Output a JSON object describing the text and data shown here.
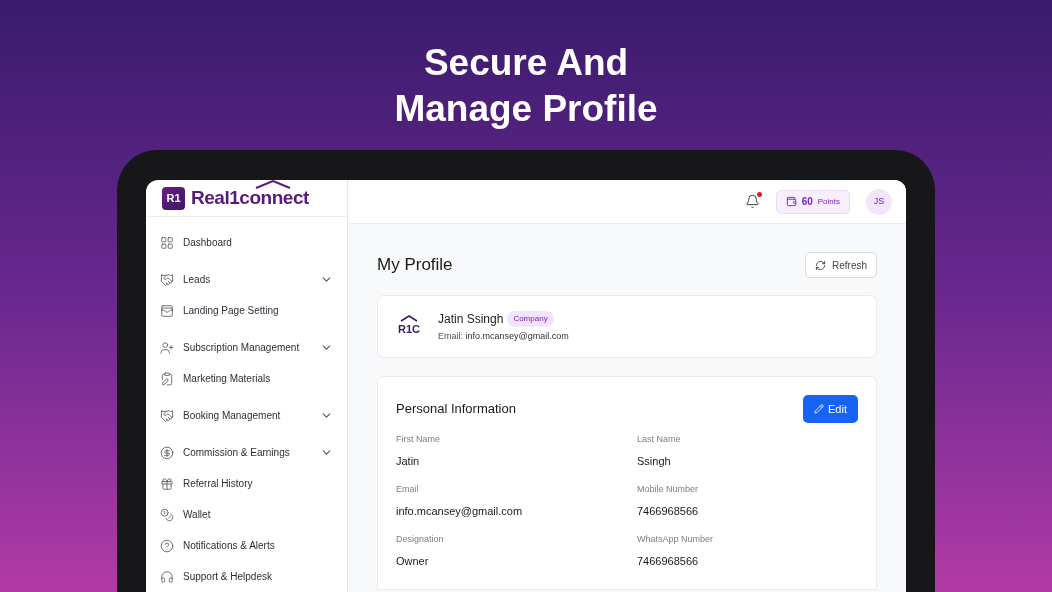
{
  "headline": [
    "Secure And",
    "Manage Profile"
  ],
  "logo": {
    "badge": "R1",
    "name": "Real1connect"
  },
  "sidebar": {
    "items": [
      {
        "label": "Dashboard",
        "expandable": false
      },
      {
        "label": "Leads",
        "expandable": true
      },
      {
        "label": "Landing Page Setting",
        "expandable": false
      },
      {
        "label": "Subscription Management",
        "expandable": true
      },
      {
        "label": "Marketing Materials",
        "expandable": false
      },
      {
        "label": "Booking Management",
        "expandable": true
      },
      {
        "label": "Commission & Earnings",
        "expandable": true
      },
      {
        "label": "Referral History",
        "expandable": false
      },
      {
        "label": "Wallet",
        "expandable": false
      },
      {
        "label": "Notifications & Alerts",
        "expandable": false
      },
      {
        "label": "Support & Helpdesk",
        "expandable": false
      }
    ]
  },
  "header": {
    "notification_unread": true,
    "points": "60",
    "points_label": "Points",
    "avatar": "JS"
  },
  "page": {
    "title": "My Profile",
    "refresh": "Refresh"
  },
  "profile_card": {
    "logo": "R1C",
    "name": "Jatin Ssingh",
    "tag": "Company",
    "email_label": "Email:",
    "email": "info.mcansey@gmail.com"
  },
  "personal_info": {
    "title": "Personal Information",
    "edit": "Edit",
    "fields": [
      {
        "label": "First Name",
        "value": "Jatin"
      },
      {
        "label": "Last Name",
        "value": "Ssingh"
      },
      {
        "label": "Email",
        "value": "info.mcansey@gmail.com"
      },
      {
        "label": "Mobile Number",
        "value": "7466968566"
      },
      {
        "label": "Designation",
        "value": "Owner"
      },
      {
        "label": "WhatsApp Number",
        "value": "7466968566"
      }
    ]
  }
}
